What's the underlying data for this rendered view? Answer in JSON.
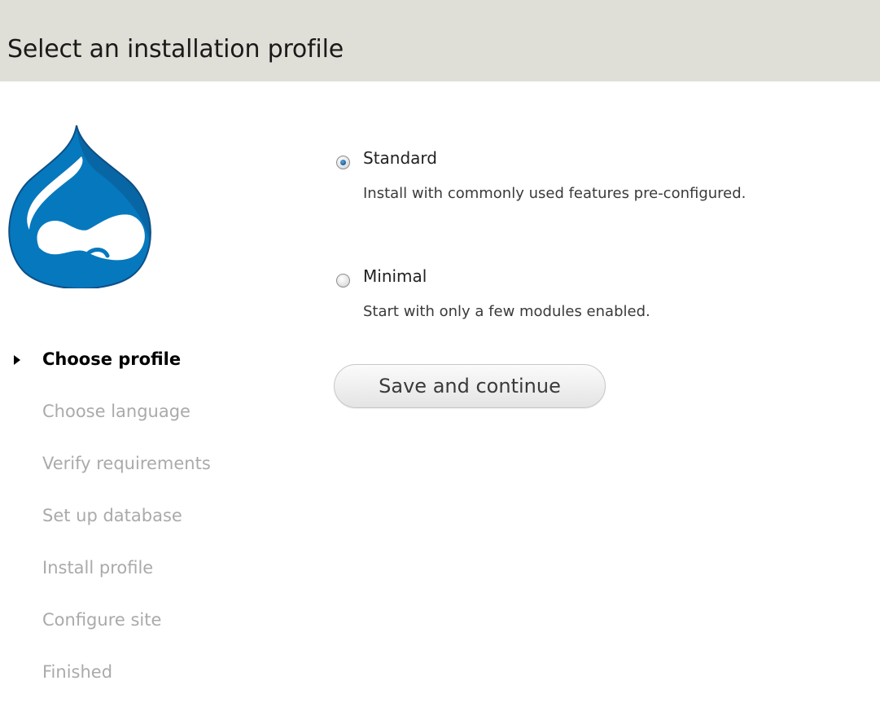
{
  "header": {
    "title": "Select an installation profile"
  },
  "logo": {
    "icon": "drupal-drop-logo-icon",
    "color": "#0678be",
    "dark_color": "#0d4f86"
  },
  "steps": [
    {
      "label": "Choose profile",
      "active": true
    },
    {
      "label": "Choose language",
      "active": false
    },
    {
      "label": "Verify requirements",
      "active": false
    },
    {
      "label": "Set up database",
      "active": false
    },
    {
      "label": "Install profile",
      "active": false
    },
    {
      "label": "Configure site",
      "active": false
    },
    {
      "label": "Finished",
      "active": false
    }
  ],
  "profiles": [
    {
      "label": "Standard",
      "description": "Install with commonly used features pre-configured.",
      "selected": true
    },
    {
      "label": "Minimal",
      "description": "Start with only a few modules enabled.",
      "selected": false
    }
  ],
  "actions": {
    "submit_label": "Save and continue"
  }
}
